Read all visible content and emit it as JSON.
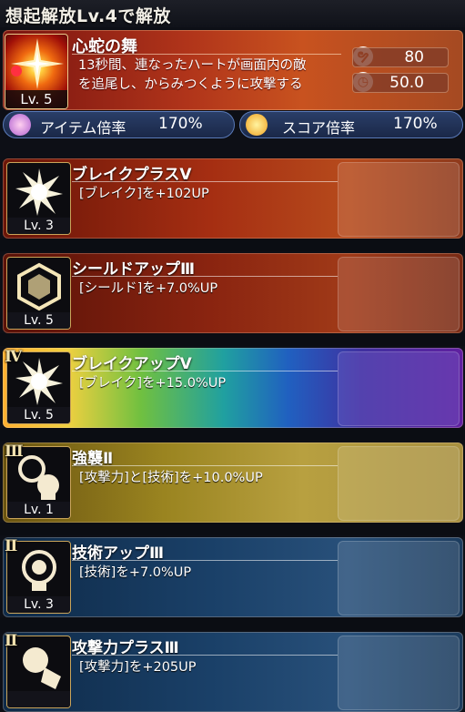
{
  "header": {
    "title": "想起解放Lv.4で解放"
  },
  "main_skill": {
    "title": "心蛇の舞",
    "level": "Lv. 5",
    "description_line1": "13秒間、連なったハートが画面内の敵",
    "description_line2": "を追尾し、からみつくように攻撃する",
    "stat_cost": "80",
    "stat_time": "50.0"
  },
  "multipliers": {
    "item_label": "アイテム倍率",
    "item_value": "170%",
    "score_label": "スコア倍率",
    "score_value": "170%"
  },
  "abilities": [
    {
      "rank": "",
      "title": "ブレイクプラスⅤ",
      "desc": "[ブレイク]を+102UP",
      "level": "Lv. 3",
      "icon": "burst-icon"
    },
    {
      "rank": "",
      "title": "シールドアップⅢ",
      "desc": "[シールド]を+7.0%UP",
      "level": "Lv. 5",
      "icon": "shield-icon"
    },
    {
      "rank": "Ⅳ",
      "title": "ブレイクアップⅤ",
      "desc": "[ブレイク]を+15.0%UP",
      "level": "Lv. 5",
      "icon": "burst-icon"
    },
    {
      "rank": "Ⅲ",
      "title": "強襲Ⅱ",
      "desc": "[攻撃力]と[技術]を+10.0%UP",
      "level": "Lv. 1",
      "icon": "head-fist-icon"
    },
    {
      "rank": "Ⅱ",
      "title": "技術アップⅢ",
      "desc": "[技術]を+7.0%UP",
      "level": "Lv. 3",
      "icon": "head-icon"
    },
    {
      "rank": "Ⅱ",
      "title": "攻撃力プラスⅢ",
      "desc": "[攻撃力]を+205UP",
      "level": "",
      "icon": "fist-icon"
    }
  ]
}
